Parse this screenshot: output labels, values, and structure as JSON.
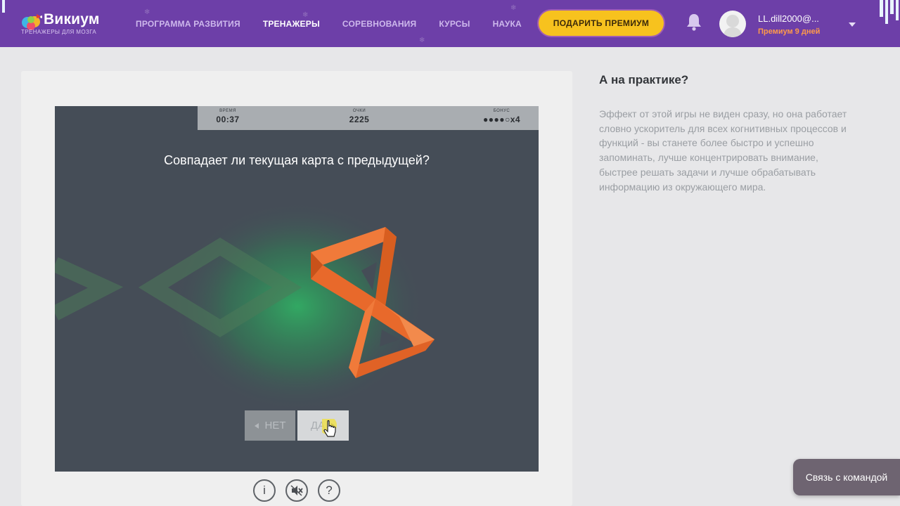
{
  "brand": {
    "name": "Викиум",
    "tagline": "ТРЕНАЖЕРЫ ДЛЯ МОЗГА"
  },
  "nav": [
    {
      "label": "ПРОГРАММА РАЗВИТИЯ",
      "active": false
    },
    {
      "label": "ТРЕНАЖЕРЫ",
      "active": true
    },
    {
      "label": "СОРЕВНОВАНИЯ",
      "active": false
    },
    {
      "label": "КУРСЫ",
      "active": false
    },
    {
      "label": "НАУКА",
      "active": false
    }
  ],
  "premium_button": "ПОДАРИТЬ ПРЕМИУМ",
  "user": {
    "name": "LL.dill2000@...",
    "status": "Премиум 9 дней"
  },
  "game": {
    "hud": {
      "time_label": "ВРЕМЯ",
      "time_value": "00:37",
      "score_label": "ОЧКИ",
      "score_value": "2225",
      "bonus_label": "БОНУС",
      "bonus_value": "●●●●○x4"
    },
    "question": "Совпадает ли текущая карта с предыдущей?",
    "no_label": "НЕТ",
    "yes_label": "ДА"
  },
  "controls": [
    "info-icon",
    "sound-off-icon",
    "help-icon"
  ],
  "sidebar": {
    "title": "А на практике?",
    "text": "Эффект от этой игры не виден сразу, но она работает словно ускоритель для всех когнитивных процессов и функций - вы станете более быстро и успешно запоминать, лучше концентрировать внимание, быстрее решать задачи и лучше обрабатывать информацию из окружающего мира."
  },
  "contact_button": "Связь с командой",
  "colors": {
    "header": "#6d3fa8",
    "accent": "#f7c21e",
    "game_bg": "#454d57",
    "shape": "#e8662a",
    "premium_status": "#ff9a4a"
  }
}
